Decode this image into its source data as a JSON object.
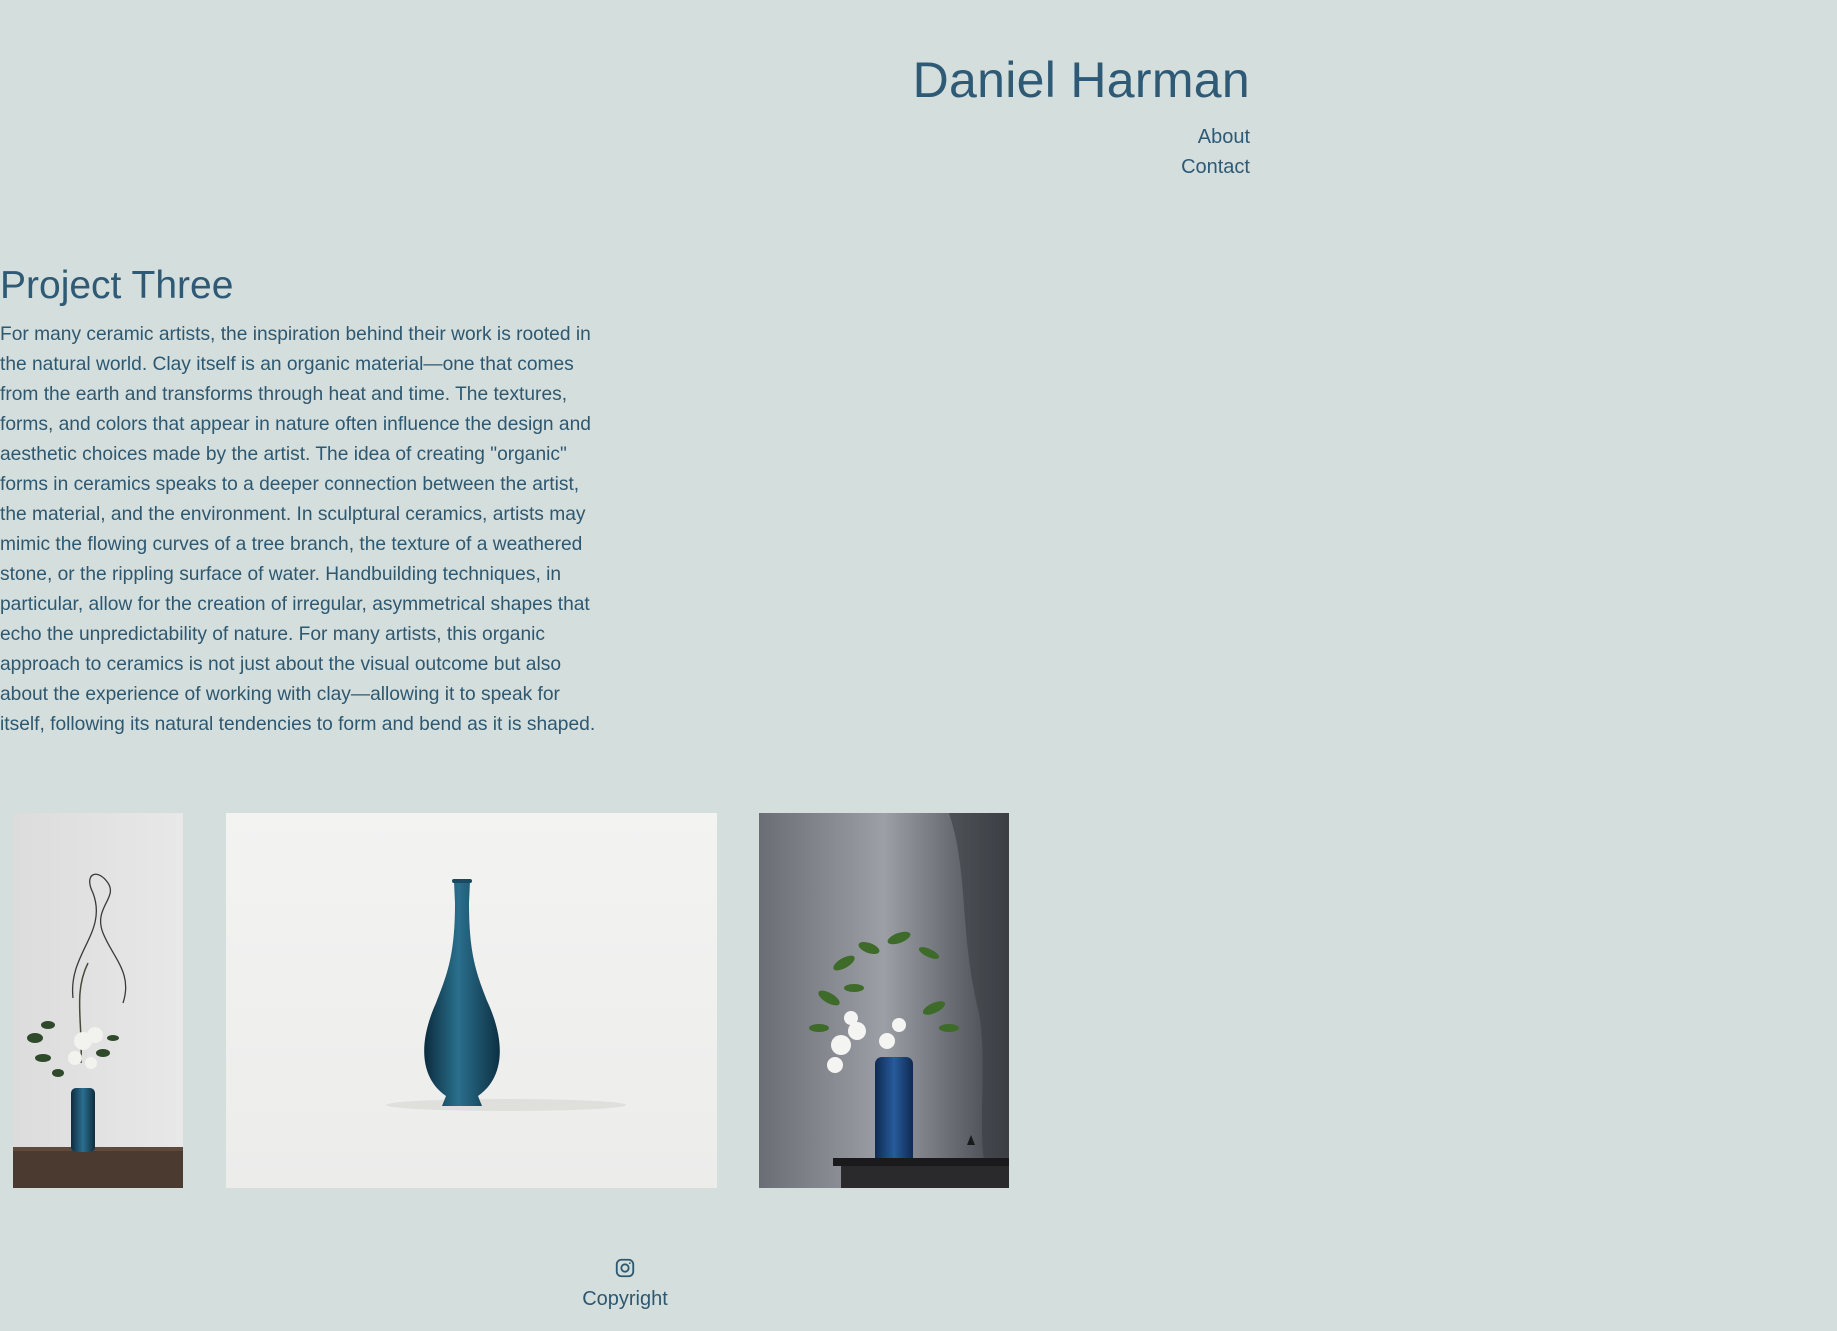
{
  "site": {
    "title": "Daniel Harman"
  },
  "nav": {
    "items": [
      {
        "label": "About"
      },
      {
        "label": "Contact"
      }
    ]
  },
  "project": {
    "title": "Project Three",
    "body": "For many ceramic artists, the inspiration behind their work is rooted in the natural world. Clay itself is an organic material—one that comes from the earth and transforms through heat and time. The textures, forms, and colors that appear in nature often influence the design and aesthetic choices made by the artist. The idea of creating \"organic\" forms in ceramics speaks to a deeper connection between the artist, the material, and the environment. In sculptural ceramics, artists may mimic the flowing curves of a tree branch, the texture of a weathered stone, or the rippling surface of water. Handbuilding techniques, in particular, allow for the creation of irregular, asymmetrical shapes that echo the unpredictability of nature. For many artists, this organic approach to ceramics is not just about the visual outcome but also about the experience of working with clay—allowing it to speak for itself, following its natural tendencies to form and bend as it is shaped."
  },
  "gallery": {
    "images": [
      {
        "icon": "vase-with-branches-photo"
      },
      {
        "icon": "blue-bottle-vase-photo"
      },
      {
        "icon": "blue-vase-with-orchids-photo"
      }
    ]
  },
  "footer": {
    "social_icon": "instagram-icon",
    "copyright": "Copyright"
  },
  "colors": {
    "background": "#d4dedd",
    "text": "#2e5870",
    "vase_blue": "#1e5270"
  }
}
